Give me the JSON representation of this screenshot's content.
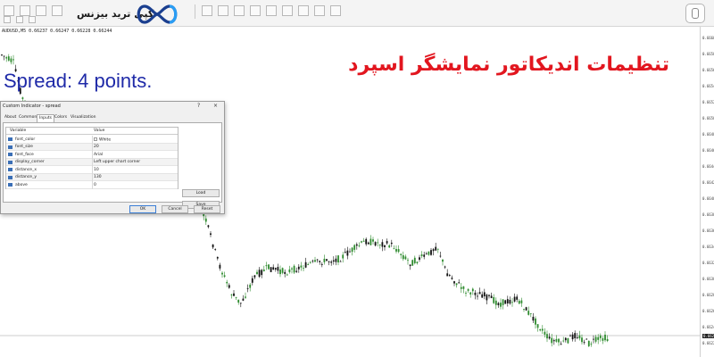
{
  "headline": "تنظیمات اندیکاتور نمایشگر اسپرد",
  "logo": {
    "text": "کپی ترید بیزنس"
  },
  "chart": {
    "symbol_line": "AUDUSD,M5  0.66237 0.66247 0.66228 0.66244",
    "spread_text": "Spread: 4 points.",
    "price_labels": [
      "0.6660",
      "0.6658",
      "0.6656",
      "0.6654",
      "0.6652",
      "0.6650",
      "0.6648",
      "0.6646",
      "0.6644",
      "0.6642",
      "0.6640",
      "0.6638",
      "0.6636",
      "0.6634",
      "0.6632",
      "0.6630",
      "0.6628",
      "0.6626",
      "0.6624",
      "0.6622"
    ],
    "current_price": "0.66244"
  },
  "dialog": {
    "title": "Custom Indicator - spread",
    "help": "?",
    "close": "×",
    "tabs": [
      "About",
      "Common",
      "Inputs",
      "Colors",
      "Visualization"
    ],
    "active_tab": "Inputs",
    "columns": {
      "variable": "Variable",
      "value": "Value"
    },
    "rows": [
      {
        "variable": "font_color",
        "value": "White"
      },
      {
        "variable": "font_size",
        "value": "20"
      },
      {
        "variable": "font_face",
        "value": "Arial"
      },
      {
        "variable": "display_corner",
        "value": "Left upper chart corner"
      },
      {
        "variable": "distance_x",
        "value": "10"
      },
      {
        "variable": "distance_y",
        "value": "130"
      },
      {
        "variable": "above",
        "value": "0"
      }
    ],
    "load_label": "Load",
    "save_label": "Save",
    "ok_label": "OK",
    "cancel_label": "Cancel",
    "reset_label": "Reset"
  },
  "colors": {
    "headline": "#e2161f",
    "spread": "#1f2aa8",
    "bull": "#2e8b2e",
    "bear": "#111111"
  }
}
